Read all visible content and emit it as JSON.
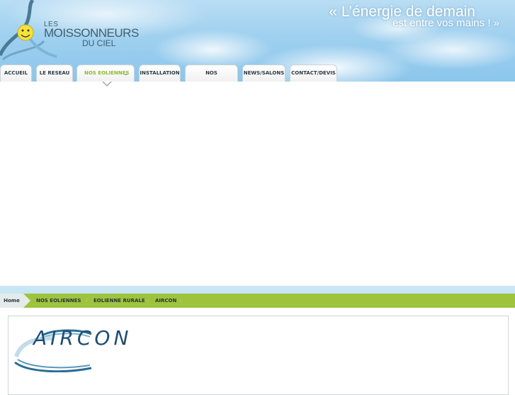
{
  "brand": {
    "logo_prefix": "LES",
    "logo_name": "MOISSONNEURS",
    "logo_suffix": "DU CIEL",
    "slogan_line1": "« L’énergie de demain",
    "slogan_line2": "est entre vos mains ! »"
  },
  "nav": {
    "tabs": [
      {
        "label": "ACCUEIL"
      },
      {
        "label": "LE RESEAU"
      },
      {
        "label": "NOS EOLIENNES",
        "active": true
      },
      {
        "label": "INSTALLATION"
      },
      {
        "label": "NOS REALISATIONS"
      },
      {
        "label": "NEWS/SALONS"
      },
      {
        "label": "CONTACT/DEVIS"
      }
    ]
  },
  "breadcrumb": {
    "items": [
      "Home",
      "NOS EOLIENNES",
      "EOLIENNE RURALE",
      "AIRCON"
    ]
  },
  "content": {
    "product_logo_text": "AIRCON"
  },
  "colors": {
    "accent_green": "#9ec43d",
    "sky_blue": "#9fd0ef",
    "text_dark": "#27353c"
  }
}
